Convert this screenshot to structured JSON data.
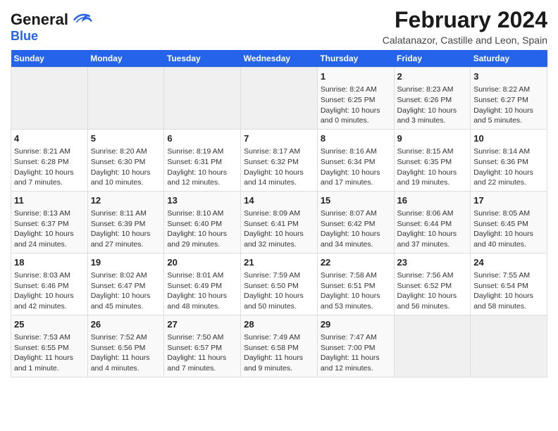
{
  "header": {
    "logo_line1": "General",
    "logo_line2": "Blue",
    "title": "February 2024",
    "subtitle": "Calatanazor, Castille and Leon, Spain"
  },
  "days_of_week": [
    "Sunday",
    "Monday",
    "Tuesday",
    "Wednesday",
    "Thursday",
    "Friday",
    "Saturday"
  ],
  "weeks": [
    [
      {
        "num": "",
        "info": ""
      },
      {
        "num": "",
        "info": ""
      },
      {
        "num": "",
        "info": ""
      },
      {
        "num": "",
        "info": ""
      },
      {
        "num": "1",
        "info": "Sunrise: 8:24 AM\nSunset: 6:25 PM\nDaylight: 10 hours\nand 0 minutes."
      },
      {
        "num": "2",
        "info": "Sunrise: 8:23 AM\nSunset: 6:26 PM\nDaylight: 10 hours\nand 3 minutes."
      },
      {
        "num": "3",
        "info": "Sunrise: 8:22 AM\nSunset: 6:27 PM\nDaylight: 10 hours\nand 5 minutes."
      }
    ],
    [
      {
        "num": "4",
        "info": "Sunrise: 8:21 AM\nSunset: 6:28 PM\nDaylight: 10 hours\nand 7 minutes."
      },
      {
        "num": "5",
        "info": "Sunrise: 8:20 AM\nSunset: 6:30 PM\nDaylight: 10 hours\nand 10 minutes."
      },
      {
        "num": "6",
        "info": "Sunrise: 8:19 AM\nSunset: 6:31 PM\nDaylight: 10 hours\nand 12 minutes."
      },
      {
        "num": "7",
        "info": "Sunrise: 8:17 AM\nSunset: 6:32 PM\nDaylight: 10 hours\nand 14 minutes."
      },
      {
        "num": "8",
        "info": "Sunrise: 8:16 AM\nSunset: 6:34 PM\nDaylight: 10 hours\nand 17 minutes."
      },
      {
        "num": "9",
        "info": "Sunrise: 8:15 AM\nSunset: 6:35 PM\nDaylight: 10 hours\nand 19 minutes."
      },
      {
        "num": "10",
        "info": "Sunrise: 8:14 AM\nSunset: 6:36 PM\nDaylight: 10 hours\nand 22 minutes."
      }
    ],
    [
      {
        "num": "11",
        "info": "Sunrise: 8:13 AM\nSunset: 6:37 PM\nDaylight: 10 hours\nand 24 minutes."
      },
      {
        "num": "12",
        "info": "Sunrise: 8:11 AM\nSunset: 6:39 PM\nDaylight: 10 hours\nand 27 minutes."
      },
      {
        "num": "13",
        "info": "Sunrise: 8:10 AM\nSunset: 6:40 PM\nDaylight: 10 hours\nand 29 minutes."
      },
      {
        "num": "14",
        "info": "Sunrise: 8:09 AM\nSunset: 6:41 PM\nDaylight: 10 hours\nand 32 minutes."
      },
      {
        "num": "15",
        "info": "Sunrise: 8:07 AM\nSunset: 6:42 PM\nDaylight: 10 hours\nand 34 minutes."
      },
      {
        "num": "16",
        "info": "Sunrise: 8:06 AM\nSunset: 6:44 PM\nDaylight: 10 hours\nand 37 minutes."
      },
      {
        "num": "17",
        "info": "Sunrise: 8:05 AM\nSunset: 6:45 PM\nDaylight: 10 hours\nand 40 minutes."
      }
    ],
    [
      {
        "num": "18",
        "info": "Sunrise: 8:03 AM\nSunset: 6:46 PM\nDaylight: 10 hours\nand 42 minutes."
      },
      {
        "num": "19",
        "info": "Sunrise: 8:02 AM\nSunset: 6:47 PM\nDaylight: 10 hours\nand 45 minutes."
      },
      {
        "num": "20",
        "info": "Sunrise: 8:01 AM\nSunset: 6:49 PM\nDaylight: 10 hours\nand 48 minutes."
      },
      {
        "num": "21",
        "info": "Sunrise: 7:59 AM\nSunset: 6:50 PM\nDaylight: 10 hours\nand 50 minutes."
      },
      {
        "num": "22",
        "info": "Sunrise: 7:58 AM\nSunset: 6:51 PM\nDaylight: 10 hours\nand 53 minutes."
      },
      {
        "num": "23",
        "info": "Sunrise: 7:56 AM\nSunset: 6:52 PM\nDaylight: 10 hours\nand 56 minutes."
      },
      {
        "num": "24",
        "info": "Sunrise: 7:55 AM\nSunset: 6:54 PM\nDaylight: 10 hours\nand 58 minutes."
      }
    ],
    [
      {
        "num": "25",
        "info": "Sunrise: 7:53 AM\nSunset: 6:55 PM\nDaylight: 11 hours\nand 1 minute."
      },
      {
        "num": "26",
        "info": "Sunrise: 7:52 AM\nSunset: 6:56 PM\nDaylight: 11 hours\nand 4 minutes."
      },
      {
        "num": "27",
        "info": "Sunrise: 7:50 AM\nSunset: 6:57 PM\nDaylight: 11 hours\nand 7 minutes."
      },
      {
        "num": "28",
        "info": "Sunrise: 7:49 AM\nSunset: 6:58 PM\nDaylight: 11 hours\nand 9 minutes."
      },
      {
        "num": "29",
        "info": "Sunrise: 7:47 AM\nSunset: 7:00 PM\nDaylight: 11 hours\nand 12 minutes."
      },
      {
        "num": "",
        "info": ""
      },
      {
        "num": "",
        "info": ""
      }
    ]
  ]
}
